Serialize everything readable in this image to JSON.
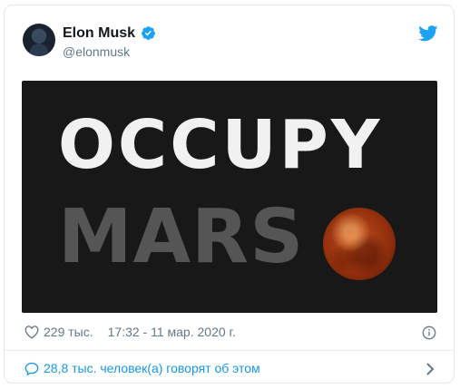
{
  "tweet": {
    "author_name": "Elon Musk",
    "author_handle": "@elonmusk",
    "image_text_line1": "OCCUPY",
    "image_text_line2": "MARS",
    "likes": "229 тыс.",
    "timestamp": "17:32 - 11 мар. 2020 г.",
    "conversation_text": "28,8 тыс. человек(а) говорят об этом"
  },
  "icons": {
    "verified": "verified-badge-icon",
    "brand": "twitter-bird-icon",
    "like": "heart-icon",
    "info": "info-icon",
    "reply": "comment-bubble-icon",
    "chevron": "chevron-right-icon"
  },
  "colors": {
    "twitter_blue": "#1da1f2",
    "link_blue": "#1b95e0",
    "meta_gray": "#657786",
    "name_black": "#14171a",
    "image_bg": "#181818",
    "mars_red": "#c4501d"
  }
}
